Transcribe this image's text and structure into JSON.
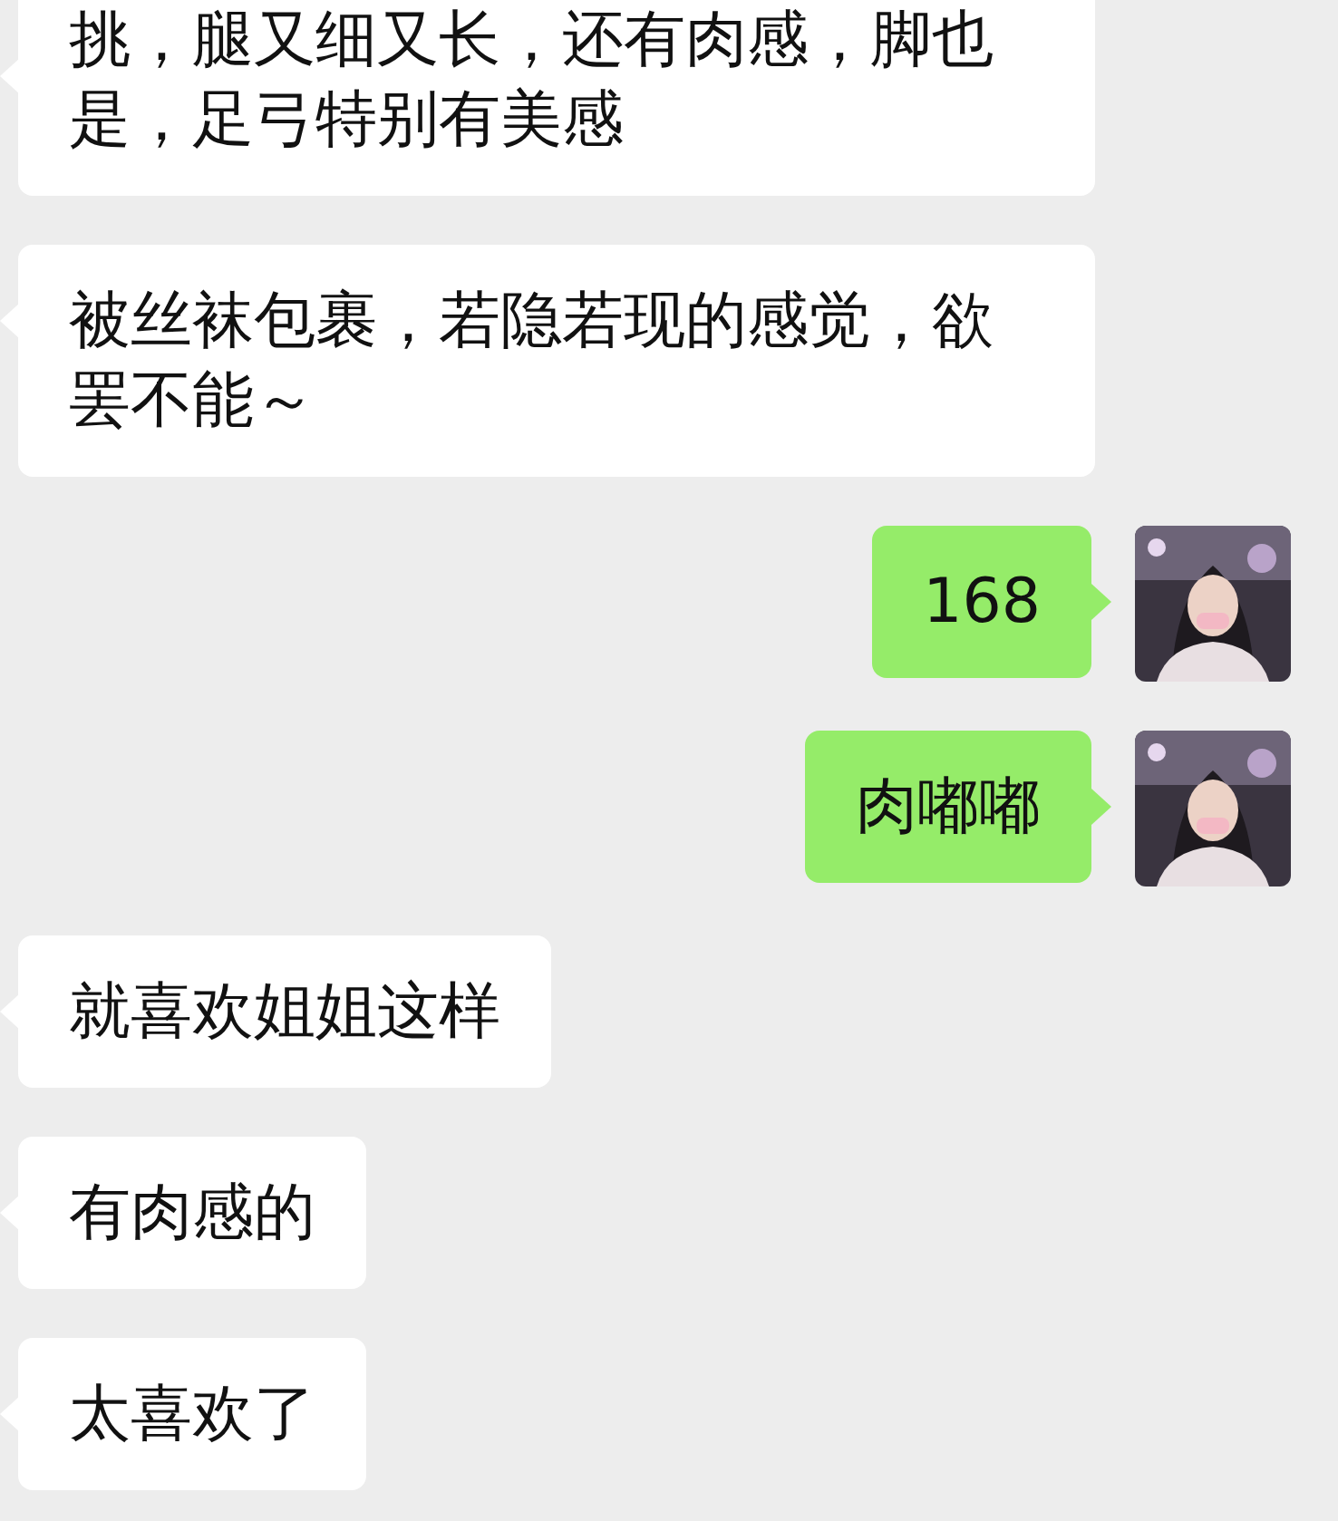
{
  "messages": [
    {
      "kind": "incoming",
      "text": "挑，腿又细又长，还有肉感，脚也是，足弓特别有美感",
      "cut_top": true
    },
    {
      "kind": "incoming",
      "text": "被丝袜包裹，若隐若现的感觉，欲罢不能～",
      "cut_top": false
    },
    {
      "kind": "outgoing",
      "text": "168",
      "cut_top": false
    },
    {
      "kind": "outgoing",
      "text": "肉嘟嘟",
      "cut_top": false
    },
    {
      "kind": "incoming",
      "text": "就喜欢姐姐这样",
      "cut_top": false
    },
    {
      "kind": "incoming",
      "text": "有肉感的",
      "cut_top": false
    },
    {
      "kind": "incoming",
      "text": "太喜欢了",
      "cut_top": false
    }
  ]
}
